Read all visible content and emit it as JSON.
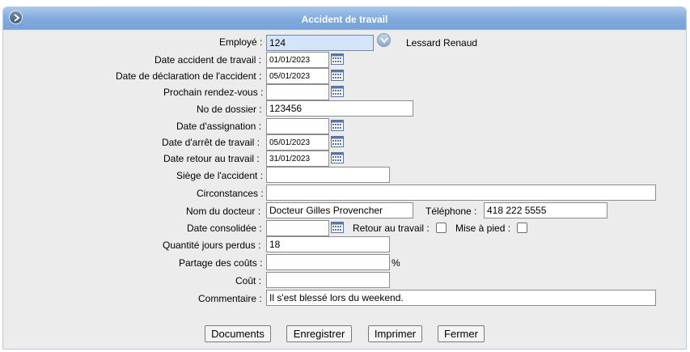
{
  "window": {
    "title": "Accident de travail"
  },
  "employee": {
    "label": "Employé :",
    "code": "124",
    "name": "Lessard Renaud"
  },
  "fields": {
    "date_accident": {
      "label": "Date accident de travail :",
      "value": "01/01/2023"
    },
    "date_declaration": {
      "label": "Date de déclaration de l'accident :",
      "value": "05/01/2023"
    },
    "prochain_rdv": {
      "label": "Prochain rendez-vous :",
      "value": ""
    },
    "no_dossier": {
      "label": "No de dossier :",
      "value": "123456"
    },
    "date_assignation": {
      "label": "Date d'assignation :",
      "value": ""
    },
    "date_arret": {
      "label": "Date d'arrêt de travail :",
      "value": "05/01/2023"
    },
    "date_retour": {
      "label": "Date retour au travail :",
      "value": "31/01/2023"
    },
    "siege": {
      "label": "Siège de l'accident :",
      "value": ""
    },
    "circonstances": {
      "label": "Circonstances :",
      "value": ""
    },
    "docteur": {
      "label": "Nom du docteur :",
      "value": "Docteur Gilles Provencher"
    },
    "telephone": {
      "label": "Téléphone :",
      "value": "418 222 5555"
    },
    "date_consolidee": {
      "label": "Date consolidée :",
      "value": ""
    },
    "retour_travail": {
      "label": "Retour au travail :",
      "checked": false
    },
    "mise_a_pied": {
      "label": "Mise à pied :",
      "checked": false
    },
    "jours_perdus": {
      "label": "Quantité jours perdus :",
      "value": "18"
    },
    "partage_couts": {
      "label": "Partage des coûts :",
      "value": "",
      "unit": "%"
    },
    "cout": {
      "label": "Coût :",
      "value": ""
    },
    "commentaire": {
      "label": "Commentaire :",
      "value": "Il s'est blessé lors du weekend."
    }
  },
  "buttons": {
    "documents": "Documents",
    "enregistrer": "Enregistrer",
    "imprimer": "Imprimer",
    "fermer": "Fermer"
  },
  "icons": {
    "title": "circle-arrow-icon",
    "calendar": "calendar-icon",
    "employee_lookup": "chevron-down-icon"
  },
  "colors": {
    "title_bar": "#7fa9dd",
    "panel_bg": "#ececec",
    "highlight_input": "#d3e4fb"
  }
}
